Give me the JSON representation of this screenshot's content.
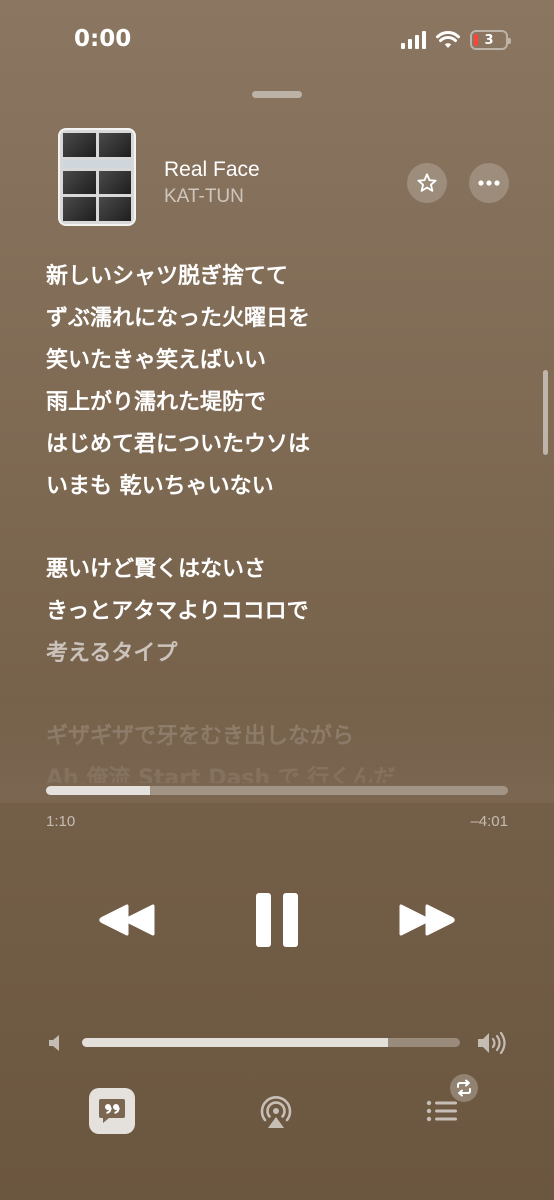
{
  "status_bar": {
    "time": "0:00",
    "battery_level": "3",
    "battery_color": "#ff453a"
  },
  "now_playing": {
    "title": "Real Face",
    "artist": "KAT-TUN",
    "favorite_icon": "star-icon",
    "more_icon": "ellipsis-icon"
  },
  "lyrics": {
    "lines": [
      "新しいシャツ脱ぎ捨てて",
      "ずぶ濡れになった火曜日を",
      "笑いたきゃ笑えばいい",
      "雨上がり濡れた堤防で",
      "はじめて君についたウソは",
      "いまも 乾いちゃいない",
      "悪いけど賢くはないさ",
      "きっとアタマよりココロで",
      "考えるタイプ",
      "ギザギザで牙をむき出しながら",
      "Ah 俺流 Start Dash で 行くんだ"
    ]
  },
  "playback": {
    "elapsed": "1:10",
    "remaining": "–4:01",
    "progress": 0.225,
    "volume": 0.81
  },
  "controls": {
    "rewind_icon": "rewind-icon",
    "pause_icon": "pause-icon",
    "forward_icon": "fast-forward-icon"
  },
  "bottom_bar": {
    "lyrics_icon": "quote-bubble-icon",
    "airplay_icon": "airplay-icon",
    "queue_icon": "queue-list-icon",
    "repeat_icon": "repeat-icon"
  }
}
